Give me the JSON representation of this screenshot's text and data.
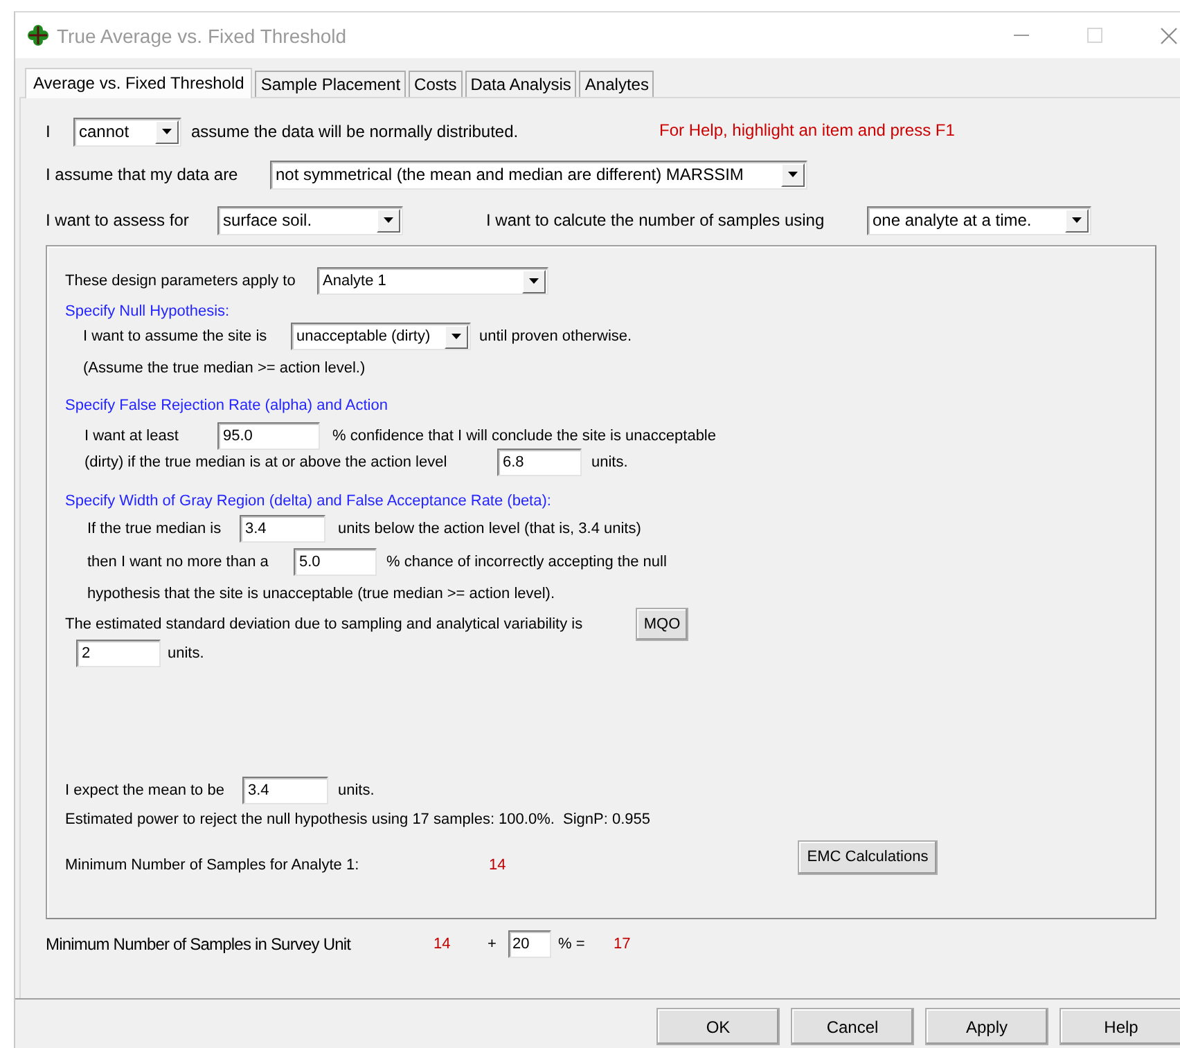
{
  "window": {
    "title": "True Average vs. Fixed Threshold"
  },
  "tabs": [
    {
      "label": "Average vs. Fixed Threshold",
      "selected": true
    },
    {
      "label": "Sample Placement",
      "selected": false
    },
    {
      "label": "Costs",
      "selected": false
    },
    {
      "label": "Data Analysis",
      "selected": false
    },
    {
      "label": "Analytes",
      "selected": false
    }
  ],
  "help_text": "For Help, highlight an item and press F1",
  "distribution": {
    "label_before": "I",
    "value": "cannot",
    "label_after": "assume the data will be normally distributed."
  },
  "data_assumption": {
    "label": "I assume that my data are",
    "value": "not symmetrical (the mean and median are different) MARSSIM"
  },
  "assess": {
    "label": "I want to assess for",
    "value": "surface soil."
  },
  "calculate": {
    "label": "I want to calcute the number of samples using",
    "value": "one analyte at a time."
  },
  "design": {
    "apply_label": "These design parameters apply to",
    "analyte": "Analyte 1",
    "null_heading": "Specify Null Hypothesis:",
    "null_label": "I want to assume the site is",
    "null_value": "unacceptable (dirty)",
    "null_after": "until proven otherwise.",
    "null_note": "(Assume the true median >= action level.)",
    "alpha_heading": "Specify False Rejection Rate (alpha) and Action",
    "alpha_before": "I want at least",
    "alpha_value": "95.0",
    "alpha_after": "% confidence that I will conclude the site is unacceptable",
    "action_before": "(dirty) if the true median is at or above the action level",
    "action_value": "6.8",
    "action_after": "units.",
    "beta_heading": "Specify Width of Gray Region (delta) and False Acceptance Rate (beta):",
    "delta_before": "If the true median is",
    "delta_value": "3.4",
    "delta_after": "units below the action level (that is, 3.4 units)",
    "beta_before": "then I want no more than a",
    "beta_value": "5.0",
    "beta_after": "% chance of incorrectly accepting the null",
    "beta_note": "hypothesis that the site is unacceptable (true median >= action level).",
    "sd_label": "The estimated standard deviation due to sampling and analytical variability is",
    "mqo_button": "MQO",
    "sd_value": "2",
    "sd_after": "units.",
    "mean_before": "I expect the mean to be",
    "mean_value": "3.4",
    "mean_after": "units.",
    "power_text": "Estimated power to reject the null hypothesis using 17 samples: 100.0%.  SignP: 0.955",
    "min_label": "Minimum Number of Samples for Analyte 1:",
    "min_value": "14",
    "emc_button": "EMC Calculations"
  },
  "survey": {
    "label": "Minimum Number of Samples in Survey Unit",
    "base": "14",
    "plus": "+",
    "percent": "20",
    "percent_label": "% =",
    "total": "17"
  },
  "buttons": [
    "OK",
    "Cancel",
    "Apply",
    "Help"
  ]
}
